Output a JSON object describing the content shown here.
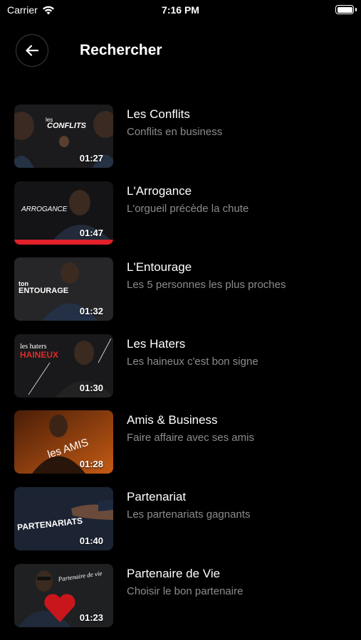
{
  "status_bar": {
    "carrier": "Carrier",
    "time": "7:16 PM"
  },
  "header": {
    "title": "Rechercher",
    "back_icon": "arrow-left-icon"
  },
  "videos": [
    {
      "title": "Les Conflits",
      "subtitle": "Conflits en business",
      "duration": "01:27",
      "thumb_text_1": "les",
      "thumb_text_2": "CONFLITS"
    },
    {
      "title": "L'Arrogance",
      "subtitle": "L'orgueil précède la chute",
      "duration": "01:47",
      "thumb_text_1": "ARROGANCE",
      "thumb_text_2": ""
    },
    {
      "title": "L'Entourage",
      "subtitle": "Les 5 personnes les plus proches",
      "duration": "01:32",
      "thumb_text_1": "ton",
      "thumb_text_2": "ENTOURAGE"
    },
    {
      "title": "Les Haters",
      "subtitle": "Les haineux c'est bon signe",
      "duration": "01:30",
      "thumb_text_1": "les haters",
      "thumb_text_2": "HAINEUX"
    },
    {
      "title": "Amis & Business",
      "subtitle": "Faire affaire avec ses amis",
      "duration": "01:28",
      "thumb_text_1": "les AMIS",
      "thumb_text_2": ""
    },
    {
      "title": "Partenariat",
      "subtitle": "Les partenariats gagnants",
      "duration": "01:40",
      "thumb_text_1": "PARTENARIATS",
      "thumb_text_2": ""
    },
    {
      "title": "Partenaire de Vie",
      "subtitle": "Choisir le bon partenaire",
      "duration": "01:23",
      "thumb_text_1": "Partenaire de vie",
      "thumb_text_2": ""
    }
  ]
}
